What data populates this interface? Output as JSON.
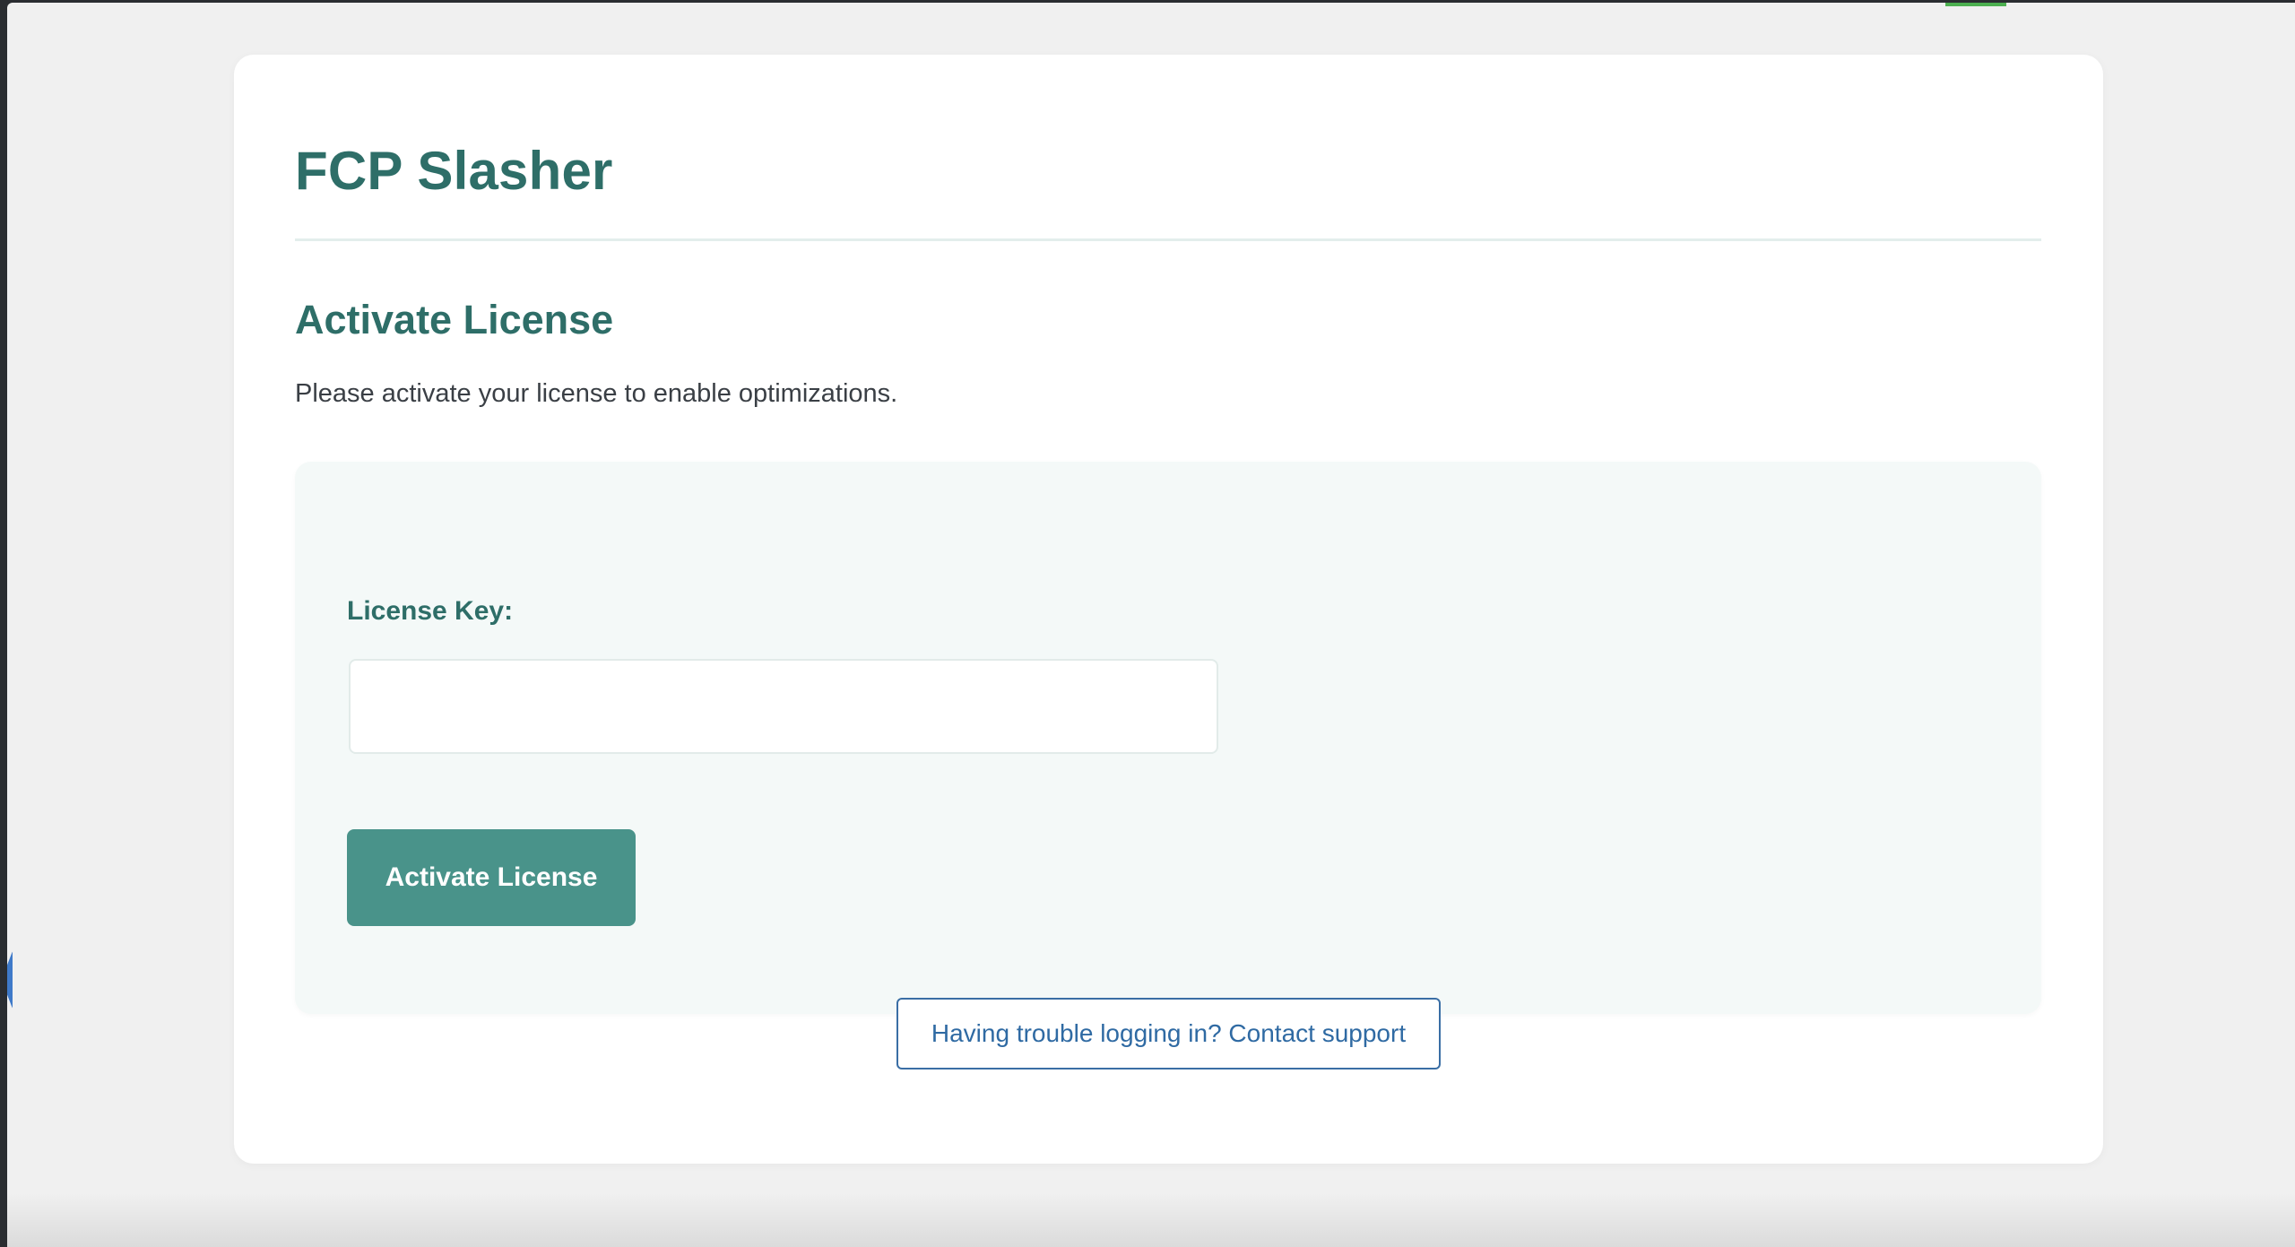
{
  "app": {
    "title": "FCP Slasher"
  },
  "license_section": {
    "title": "Activate License",
    "description": "Please activate your license to enable optimizations.",
    "field_label": "License Key:",
    "input_value": "",
    "input_placeholder": "",
    "button_label": "Activate License"
  },
  "support": {
    "link_text": "Having trouble logging in? Contact support"
  },
  "colors": {
    "brand": "#2e6e68",
    "button": "#49938a",
    "panel": "#f4f9f8",
    "link": "#2f6aa3"
  }
}
